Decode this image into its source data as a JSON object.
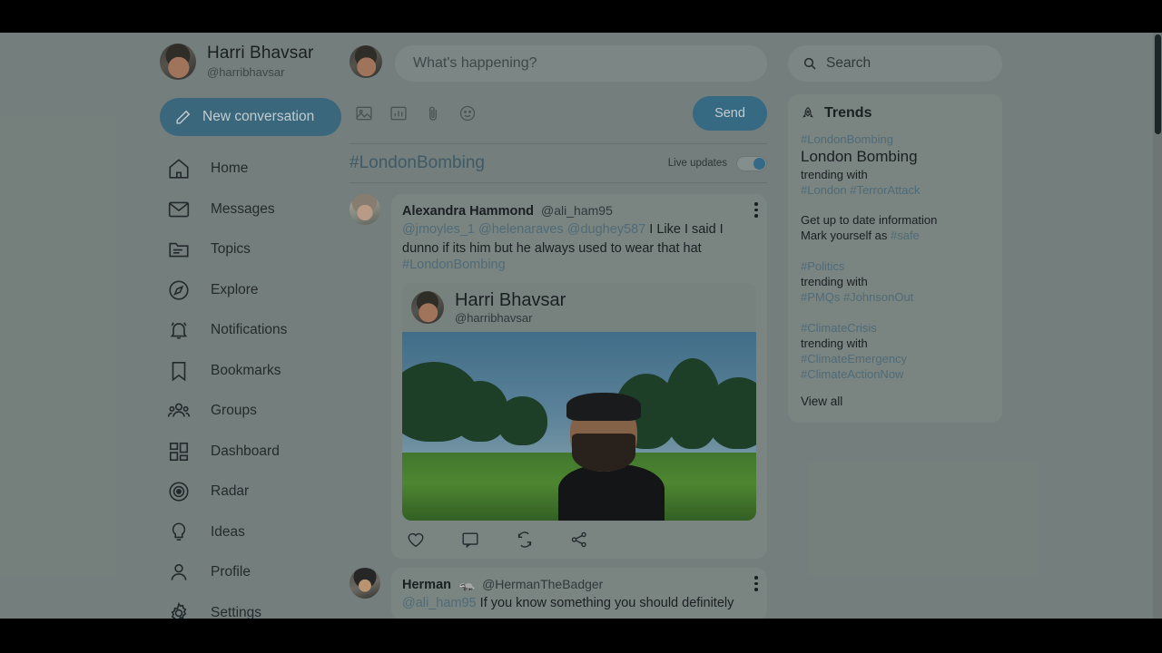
{
  "sidebar": {
    "profile": {
      "name": "Harri Bhavsar",
      "handle": "@harribhavsar",
      "avatar_icon": "harri-avatar"
    },
    "new_conversation_label": "New conversation",
    "items": [
      {
        "label": "Home",
        "icon": "home-icon"
      },
      {
        "label": "Messages",
        "icon": "envelope-icon"
      },
      {
        "label": "Topics",
        "icon": "folder-icon"
      },
      {
        "label": "Explore",
        "icon": "compass-icon"
      },
      {
        "label": "Notifications",
        "icon": "bell-icon"
      },
      {
        "label": "Bookmarks",
        "icon": "bookmark-icon"
      },
      {
        "label": "Groups",
        "icon": "people-icon"
      },
      {
        "label": "Dashboard",
        "icon": "grid-icon"
      },
      {
        "label": "Radar",
        "icon": "radar-icon"
      },
      {
        "label": "Ideas",
        "icon": "lightbulb-icon"
      },
      {
        "label": "Profile",
        "icon": "person-icon"
      },
      {
        "label": "Settings",
        "icon": "gear-icon"
      }
    ]
  },
  "composer": {
    "placeholder": "What's happening?",
    "value": "",
    "send_label": "Send",
    "tools": [
      {
        "icon": "image-icon"
      },
      {
        "icon": "poll-icon"
      },
      {
        "icon": "attachment-icon"
      },
      {
        "icon": "emoji-icon"
      }
    ]
  },
  "feed_header": {
    "hashtag": "#LondonBombing",
    "live_updates_label": "Live updates",
    "live_updates_on": true
  },
  "posts": [
    {
      "author": "Alexandra Hammond",
      "handle": "@ali_ham95",
      "avatar_icon": "alexandra-avatar",
      "mentions": "@jmoyles_1 @helenaraves @dughey587",
      "text": " I Like I said I dunno if its him but he always used to wear that hat",
      "hashtag": "#LondonBombing",
      "more_icon": "more-vertical-icon",
      "quote": {
        "author": "Harri Bhavsar",
        "handle": "@harribhavsar",
        "avatar_icon": "harri-avatar",
        "image_alt": "man-in-backwards-cap-in-park-photo"
      },
      "actions": [
        {
          "icon": "heart-icon"
        },
        {
          "icon": "comment-icon"
        },
        {
          "icon": "retweet-icon"
        },
        {
          "icon": "share-icon"
        }
      ]
    },
    {
      "author": "Herman",
      "badge": "🦡",
      "handle": "@HermanTheBadger",
      "avatar_icon": "herman-avatar",
      "mentions": "@ali_ham95",
      "text": " If you know something you should definitely",
      "more_icon": "more-vertical-icon"
    }
  ],
  "search": {
    "placeholder": "Search",
    "value": "",
    "icon": "search-icon"
  },
  "trends": {
    "title": "Trends",
    "icon": "rocket-icon",
    "items": [
      {
        "tag": "#LondonBombing",
        "headline": "London Bombing",
        "trending_with_label": "trending with",
        "related": "#London #TerrorAttack"
      },
      {
        "tag": "#Politics",
        "trending_with_label": "trending with",
        "related": "#PMQs #JohnsonOut"
      },
      {
        "tag": "#ClimateCrisis",
        "trending_with_label": "trending with",
        "related_1": "#ClimateEmergency",
        "related_2": "#ClimateActionNow"
      }
    ],
    "info_line_1": "Get up to date information",
    "info_line_2_prefix": "Mark yourself as ",
    "info_safe_tag": "#safe",
    "view_all_label": "View all"
  },
  "colors": {
    "background": "#78827f",
    "panel": "#7e8885",
    "accent_blue": "#336b87",
    "link_blue": "#4f6d7a",
    "text_dark": "#14181a",
    "letterbox": "#000000"
  }
}
